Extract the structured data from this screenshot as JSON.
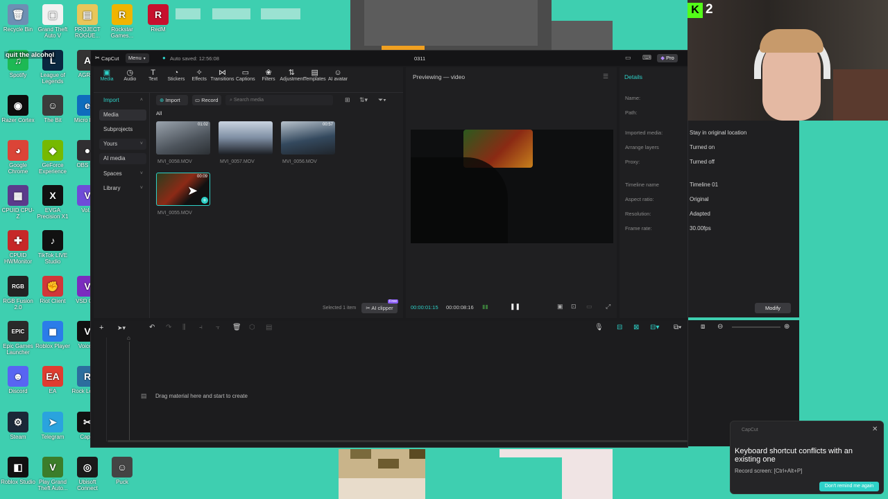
{
  "desktop": {
    "overlay_text": "quit the alcohol",
    "icons": [
      {
        "label": "Recycle Bin",
        "glyph": "🗑",
        "color": "#6d8fb3"
      },
      {
        "label": "Grand Theft Auto V",
        "glyph": "▢",
        "color": "#f2f2f2"
      },
      {
        "label": "PROJECT ROGUE...",
        "glyph": "▤",
        "color": "#e9c65a"
      },
      {
        "label": "Rockstar Games...",
        "glyph": "R",
        "color": "#f0b400"
      },
      {
        "label": "RedM",
        "glyph": "R",
        "color": "#c8102e"
      },
      {
        "label": "Spotify",
        "glyph": "♫",
        "color": "#1db954"
      },
      {
        "label": "League of Legends",
        "glyph": "L",
        "color": "#0a2740"
      },
      {
        "label": "AGRI...",
        "glyph": "A",
        "color": "#333"
      },
      {
        "label": "Razer Cortex",
        "glyph": "◉",
        "color": "#0d0d0d"
      },
      {
        "label": "The Bit",
        "glyph": "☺",
        "color": "#3b3b3b"
      },
      {
        "label": "Micro Ed...",
        "glyph": "e",
        "color": "#0f6cbd"
      },
      {
        "label": "Google Chrome",
        "glyph": "◕",
        "color": "#db4437"
      },
      {
        "label": "GeForce Experience",
        "glyph": "◆",
        "color": "#76b900"
      },
      {
        "label": "OBS S...",
        "glyph": "●",
        "color": "#302e31"
      },
      {
        "label": "CPUID CPU-Z",
        "glyph": "▦",
        "color": "#5b3b8c"
      },
      {
        "label": "EVGA Precision X1",
        "glyph": "X",
        "color": "#111"
      },
      {
        "label": "Vol...",
        "glyph": "V",
        "color": "#6f4bd8"
      },
      {
        "label": "CPUID HWMonitor",
        "glyph": "✚",
        "color": "#c62828"
      },
      {
        "label": "TikTok LIVE Studio",
        "glyph": "♪",
        "color": "#111"
      },
      {
        "label": "RGB Fusion 2.0",
        "glyph": "RGB",
        "color": "#222"
      },
      {
        "label": "Riot Client",
        "glyph": "✊",
        "color": "#d13639"
      },
      {
        "label": "VSD Gr...",
        "glyph": "V",
        "color": "#7b2cbf"
      },
      {
        "label": "Epic Games Launcher",
        "glyph": "EPIC",
        "color": "#2a2a2a"
      },
      {
        "label": "Roblox Player",
        "glyph": "◼",
        "color": "#2b7ce9"
      },
      {
        "label": "Voice...",
        "glyph": "V",
        "color": "#111"
      },
      {
        "label": "Discord",
        "glyph": "☻",
        "color": "#5865f2"
      },
      {
        "label": "EA",
        "glyph": "EA",
        "color": "#e03c31"
      },
      {
        "label": "Rock Leag...",
        "glyph": "R",
        "color": "#2c6e9e"
      },
      {
        "label": "Steam",
        "glyph": "⚙",
        "color": "#1b2838"
      },
      {
        "label": "Telegram",
        "glyph": "➤",
        "color": "#2aa3de"
      },
      {
        "label": "Cap...",
        "glyph": "✂",
        "color": "#111"
      },
      {
        "label": "Roblox Studio",
        "glyph": "◧",
        "color": "#111"
      },
      {
        "label": "Play Grand Theft Auto...",
        "glyph": "V",
        "color": "#3b7d2a"
      },
      {
        "label": "Ubisoft Connect",
        "glyph": "◎",
        "color": "#1a1a1a"
      },
      {
        "label": "Puck",
        "glyph": "☺",
        "color": "#444"
      }
    ]
  },
  "app": {
    "brand": "CapCut",
    "menu_label": "Menu",
    "autosave": "Auto saved: 12:56:08",
    "project_title": "0311",
    "pro_label": "Pro",
    "toolbar": [
      {
        "label": "Media",
        "icon": "media-icon",
        "glyph": "▣"
      },
      {
        "label": "Audio",
        "icon": "audio-icon",
        "glyph": "◷"
      },
      {
        "label": "Text",
        "icon": "text-icon",
        "glyph": "T"
      },
      {
        "label": "Stickers",
        "icon": "stickers-icon",
        "glyph": "◔"
      },
      {
        "label": "Effects",
        "icon": "effects-icon",
        "glyph": "✧"
      },
      {
        "label": "Transitions",
        "icon": "transitions-icon",
        "glyph": "⋈"
      },
      {
        "label": "Captions",
        "icon": "captions-icon",
        "glyph": "▭"
      },
      {
        "label": "Filters",
        "icon": "filters-icon",
        "glyph": "❀"
      },
      {
        "label": "Adjustment",
        "icon": "adjustment-icon",
        "glyph": "⇅"
      },
      {
        "label": "Templates",
        "icon": "templates-icon",
        "glyph": "▤"
      },
      {
        "label": "AI avatar",
        "icon": "ai-avatar-icon",
        "glyph": "☺"
      }
    ],
    "sidebar": [
      {
        "label": "Import",
        "chev": "^"
      },
      {
        "label": "Media",
        "chev": ""
      },
      {
        "label": "Subprojects",
        "chev": ""
      },
      {
        "label": "Yours",
        "chev": "v"
      },
      {
        "label": "AI media",
        "chev": ""
      },
      {
        "label": "Spaces",
        "chev": "v"
      },
      {
        "label": "Library",
        "chev": "v"
      }
    ],
    "media": {
      "import_button": "Import",
      "record_button": "Record",
      "search_placeholder": "Search media",
      "filter_all": "All",
      "clips": [
        {
          "name": "MVI_0058.MOV",
          "duration": "01:02"
        },
        {
          "name": "MVI_0057.MOV",
          "duration": ""
        },
        {
          "name": "MVI_0056.MOV",
          "duration": "00:57"
        },
        {
          "name": "MVI_0055.MOV",
          "duration": "00:09"
        }
      ],
      "selected_text": "Selected 1 item",
      "ai_clipper": "AI clipper",
      "free_badge": "Free"
    },
    "preview": {
      "title": "Previewing — video",
      "current_time": "00:00:01:15",
      "total_time": "00:00:08:16"
    },
    "details": {
      "title": "Details",
      "rows": [
        {
          "key": "Name:",
          "value": ""
        },
        {
          "key": "Path:",
          "value": ""
        },
        {
          "key": "Imported media:",
          "value": "Stay in original location"
        },
        {
          "key": "Arrange layers",
          "value": "Turned on"
        },
        {
          "key": "Proxy:",
          "value": "Turned off"
        },
        {
          "key": "Timeline name",
          "value": "Timeline 01"
        },
        {
          "key": "Aspect ratio:",
          "value": "Original"
        },
        {
          "key": "Resolution:",
          "value": "Adapted"
        },
        {
          "key": "Frame rate:",
          "value": "30.00fps"
        }
      ],
      "modify_button": "Modify"
    },
    "timeline": {
      "empty_text": "Drag material here and start to create"
    }
  },
  "stream": {
    "k_badge": "2"
  },
  "toast": {
    "app_name": "CapCut",
    "title": "Keyboard shortcut conflicts with an existing one",
    "detail": "Record screen: [Ctrl+Alt+P]",
    "action": "Don't remind me again"
  },
  "colors": {
    "desktop_bg": "#3ecfb0",
    "accent": "#2ed1c8",
    "panel": "#1f1f21",
    "window": "#1b1b1d"
  }
}
